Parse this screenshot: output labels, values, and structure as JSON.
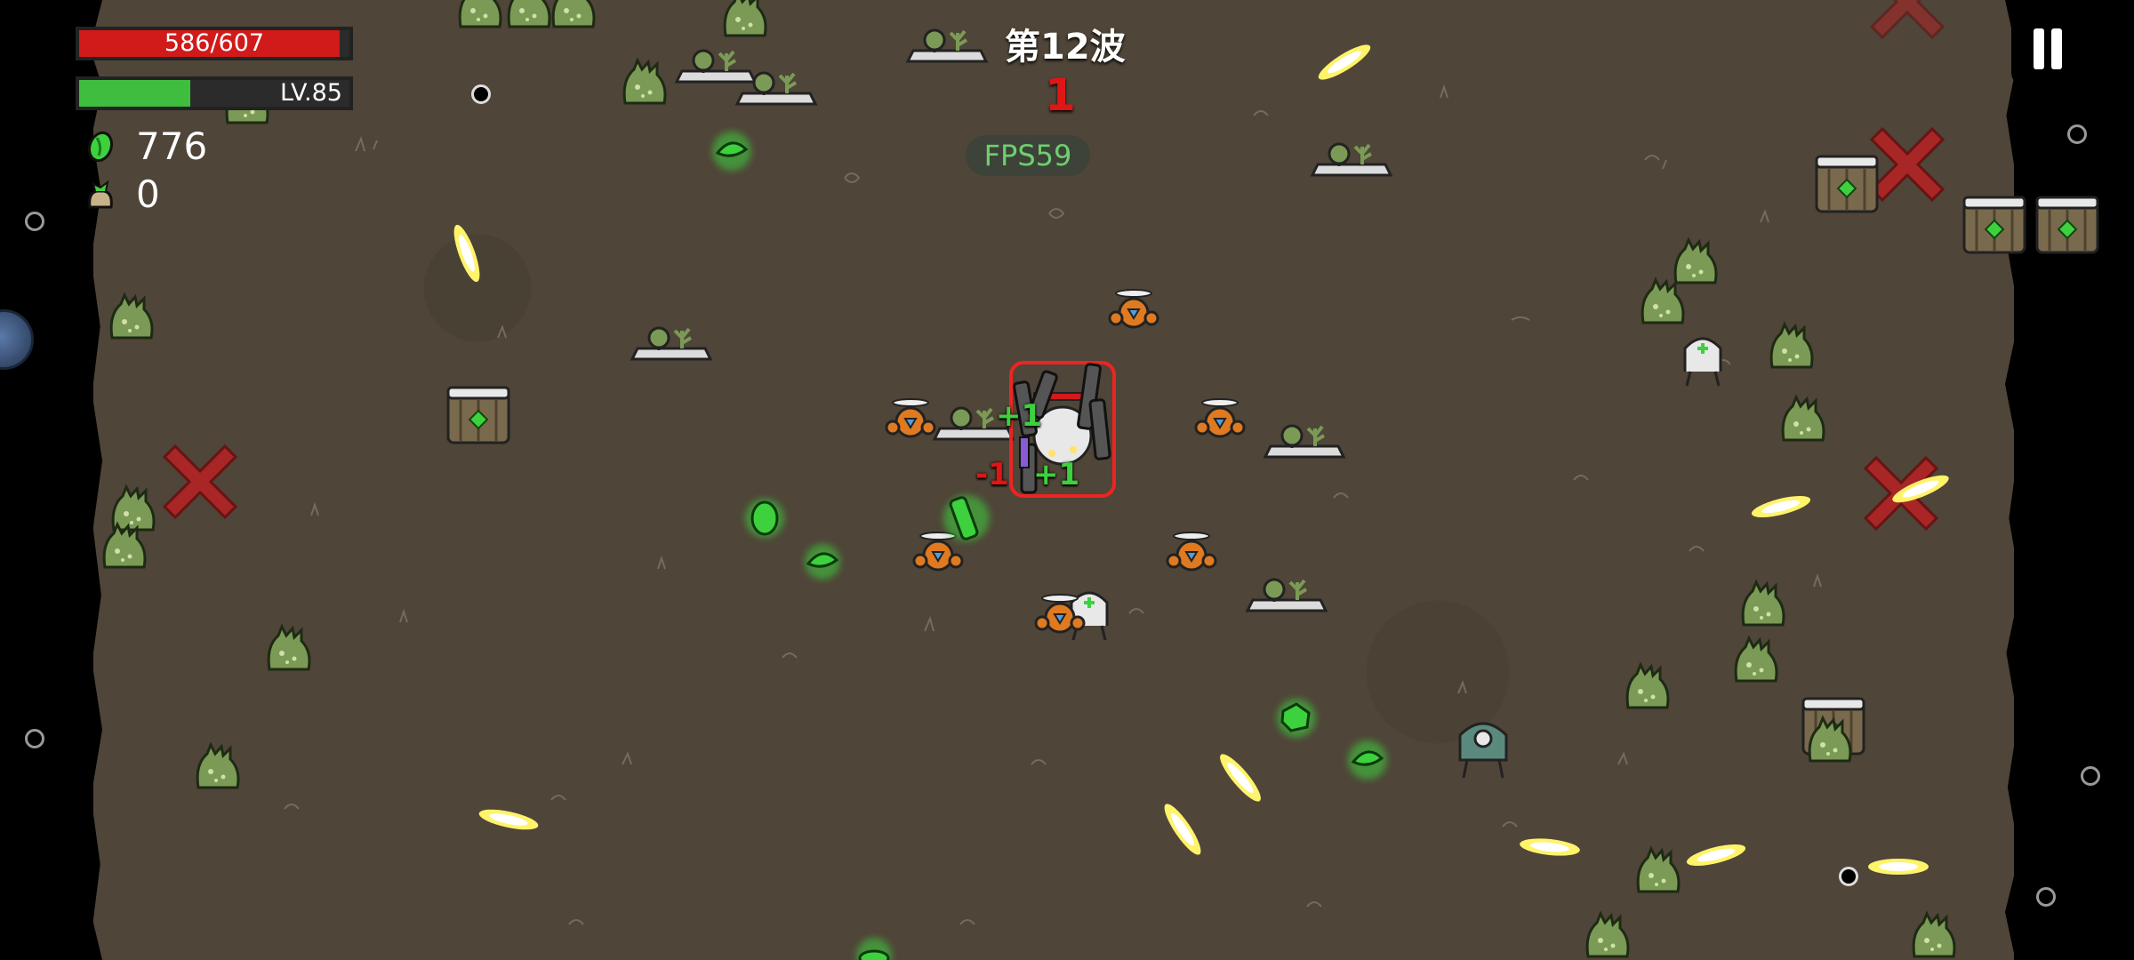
{
  "hud": {
    "hp_text": "586/607",
    "hp_fraction": 0.965,
    "level_text": "LV.85",
    "xp_fraction": 0.41,
    "materials": "776",
    "bag_count": "0"
  },
  "wave": {
    "title": "第12波",
    "timer": "1"
  },
  "fps": "FPS59",
  "damage_numbers": [
    "+1",
    "-1",
    "+1"
  ],
  "colors": {
    "hp": "#d11a1a",
    "xp": "#3fbd3f",
    "ground": "#4f4538",
    "alien": "#7a9a55",
    "drone": "#e07a20",
    "bullet": "#fff36a",
    "material": "#3dd13d",
    "danger_marker": "#cc2a2a"
  },
  "icons": {
    "materials": "green-material-icon",
    "bag": "loot-bag-icon",
    "pause": "pause-icon"
  }
}
